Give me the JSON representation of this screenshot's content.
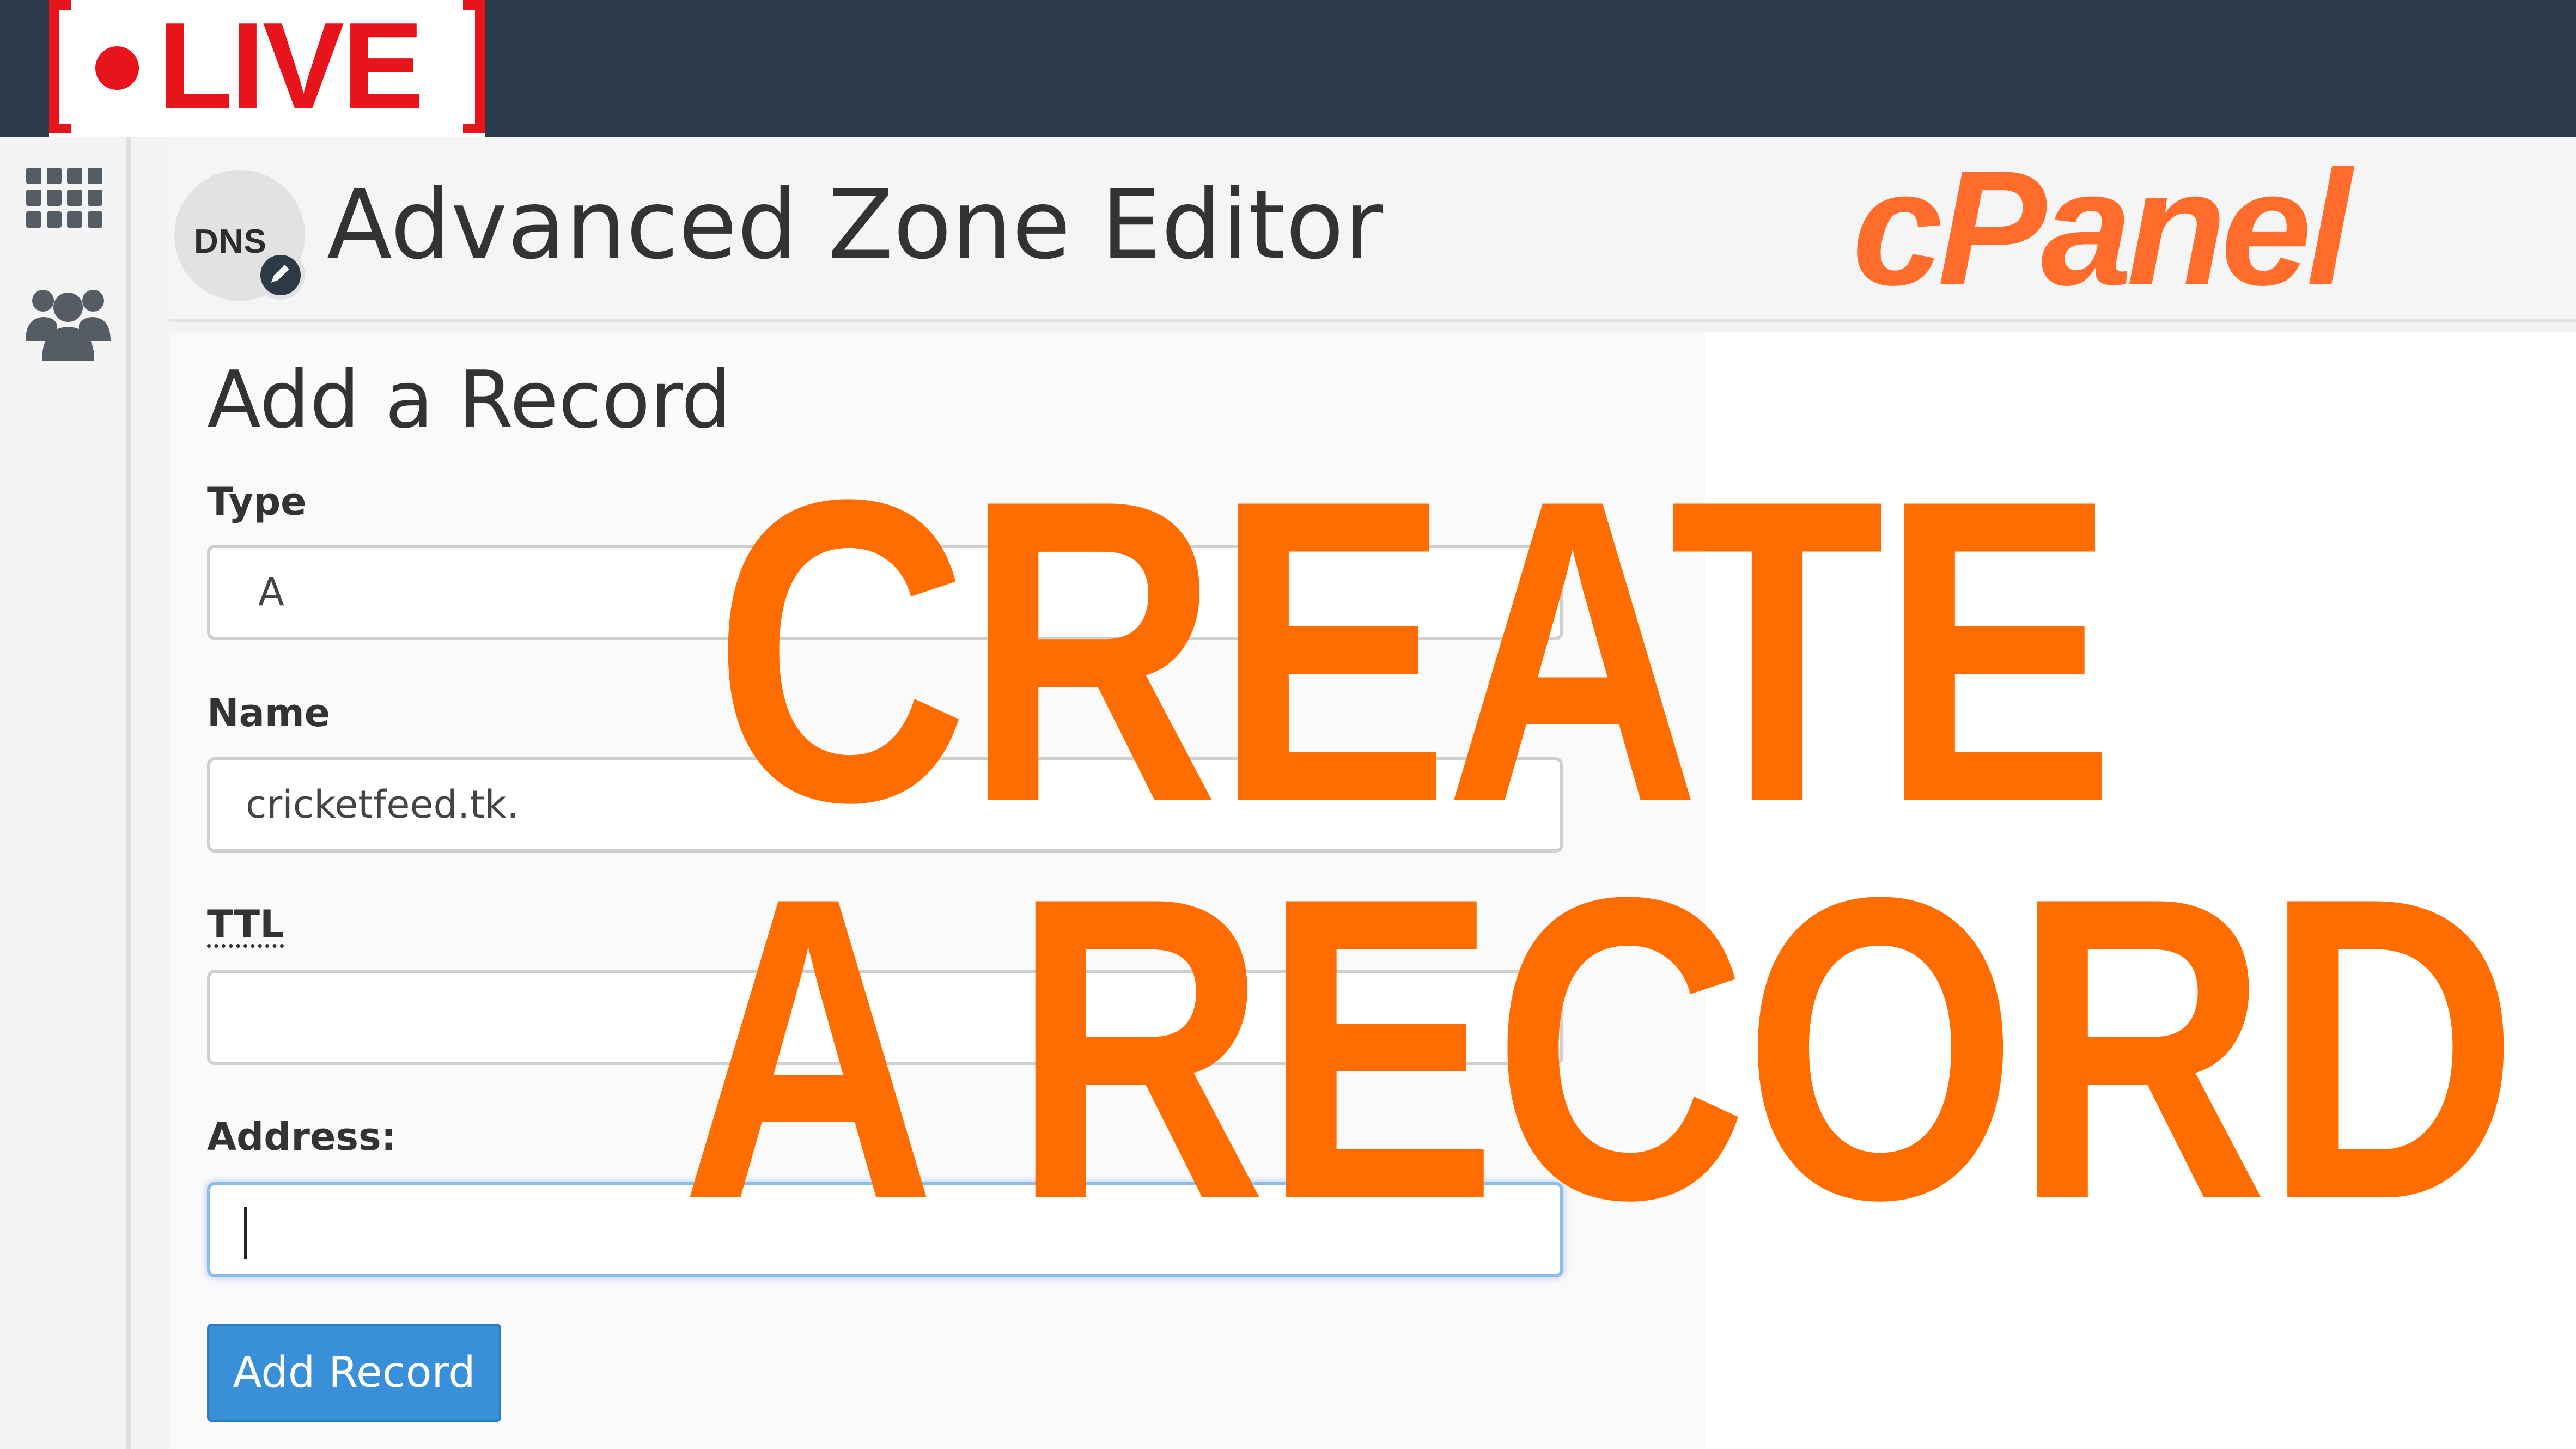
{
  "badge": {
    "live_label": "LIVE"
  },
  "header": {
    "dns_icon_label": "DNS",
    "title": "Advanced Zone Editor",
    "brand_logo": "cPanel"
  },
  "sidebar": {
    "icons": [
      "apps-grid-icon",
      "users-icon"
    ]
  },
  "form": {
    "title": "Add a Record",
    "type_label": "Type",
    "type_value": "A",
    "name_label": "Name",
    "name_value": "cricketfeed.tk.",
    "ttl_label": "TTL",
    "ttl_value": "",
    "address_label": "Address:",
    "address_value": "",
    "submit_label": "Add Record"
  },
  "overlay": {
    "line1": "CREATE",
    "line2": "A RECORD"
  },
  "colors": {
    "live_red": "#e8141c",
    "brand_orange": "#ff6d00",
    "topbar": "#2b3a4a",
    "button_blue": "#3a8fd9"
  }
}
